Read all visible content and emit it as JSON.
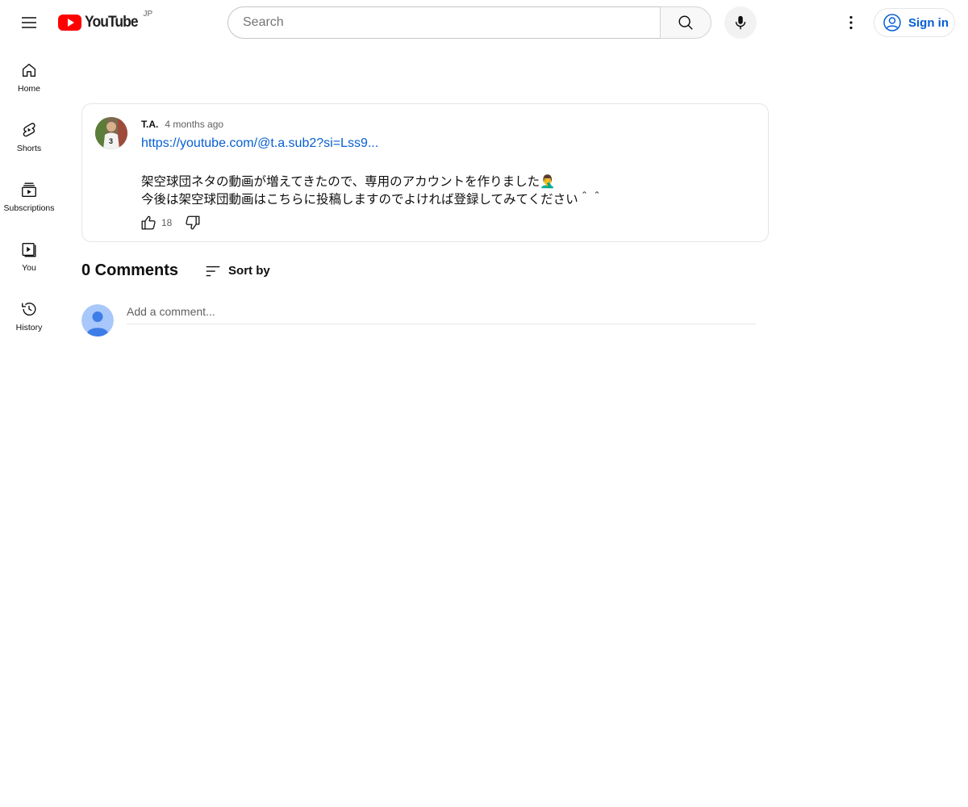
{
  "header": {
    "logo_text": "YouTube",
    "region": "JP",
    "search_placeholder": "Search",
    "signin_label": "Sign in"
  },
  "sidebar": {
    "items": [
      {
        "label": "Home",
        "icon": "home-icon"
      },
      {
        "label": "Shorts",
        "icon": "shorts-icon"
      },
      {
        "label": "Subscriptions",
        "icon": "subscriptions-icon"
      },
      {
        "label": "You",
        "icon": "you-icon"
      },
      {
        "label": "History",
        "icon": "history-icon"
      }
    ]
  },
  "post": {
    "author": "T.A.",
    "time": "4 months ago",
    "link": "https://youtube.com/@t.a.sub2?si=Lss9...",
    "lines": [
      "架空球団ネタの動画が増えてきたので、専用のアカウントを作りました🤦‍♂️",
      "今後は架空球団動画はこちらに投稿しますのでよければ登録してみてください＾＾"
    ],
    "likes": "18"
  },
  "comments": {
    "count_label": "0 Comments",
    "sort_label": "Sort by",
    "input_placeholder": "Add a comment..."
  },
  "colors": {
    "brand_red": "#ff0000",
    "link_blue": "#065fd4",
    "avatar_blue": "#3e7ce8"
  }
}
